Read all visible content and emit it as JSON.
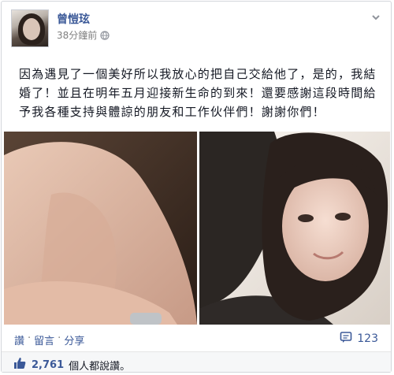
{
  "post": {
    "author": "曾愷玹",
    "time": "38分鐘前",
    "text": "因為遇見了一個美好所以我放心的把自己交給他了，是的，我結婚了！並且在明年五月迎接新生命的到來！還要感謝這段時間給予我各種支持與體諒的朋友和工作伙伴們！謝謝你們！",
    "photos": [
      "ring-hand-photo",
      "couple-embrace-photo"
    ]
  },
  "actions": {
    "like": "讚",
    "comment": "留言",
    "share": "分享",
    "separator": "·"
  },
  "stats": {
    "comments_count": "123",
    "likes_count": "2,761",
    "likes_text": "個人都說讚。"
  },
  "colors": {
    "link": "#3b5998",
    "muted": "#7f7f7f",
    "border": "#d3d6db",
    "footer_bg": "#f6f7f8"
  }
}
